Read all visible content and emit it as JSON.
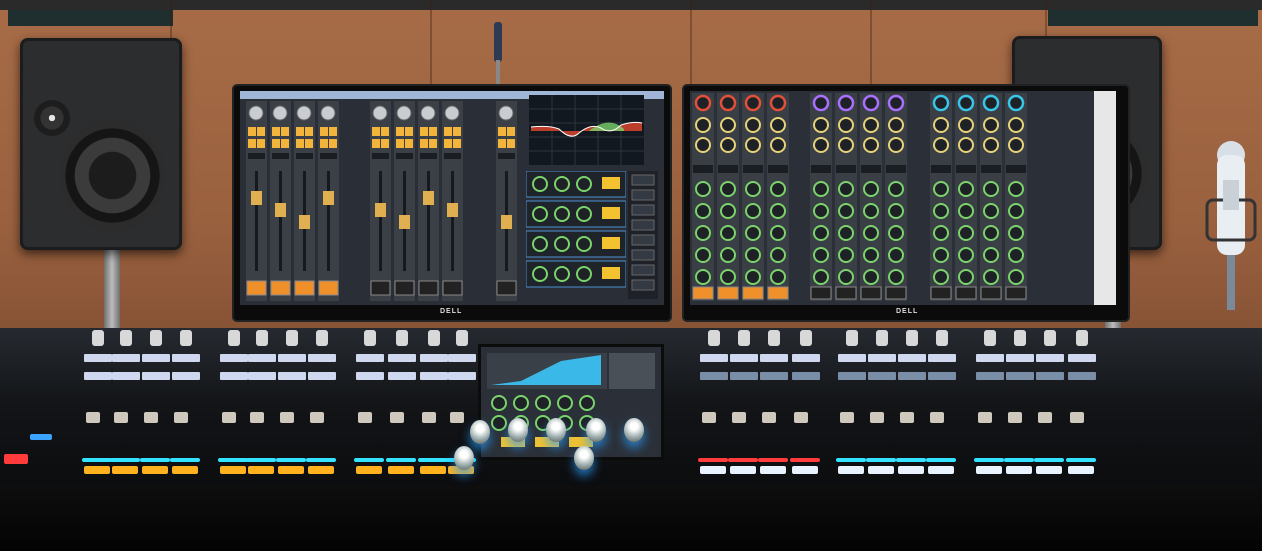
{
  "monitor_left": {
    "brand_label": "DELL"
  },
  "monitor_right": {
    "brand_label": "DELL"
  },
  "colors": {
    "wood_wall": "#9a613f",
    "screen_bg": "#2a2e36",
    "strip_bg": "#3b4047",
    "meter_green": "#7ad36b",
    "meter_red": "#e2503a",
    "accent_orange": "#f0902a",
    "accent_blue": "#3aa4ff",
    "console_red": "#ff3b3b",
    "console_cyan": "#34e3ff",
    "console_yellow": "#ffb21e"
  },
  "icons": [
    "speaker-icon",
    "microphone-icon",
    "knob-icon",
    "fader-icon",
    "eq-graph-icon"
  ]
}
